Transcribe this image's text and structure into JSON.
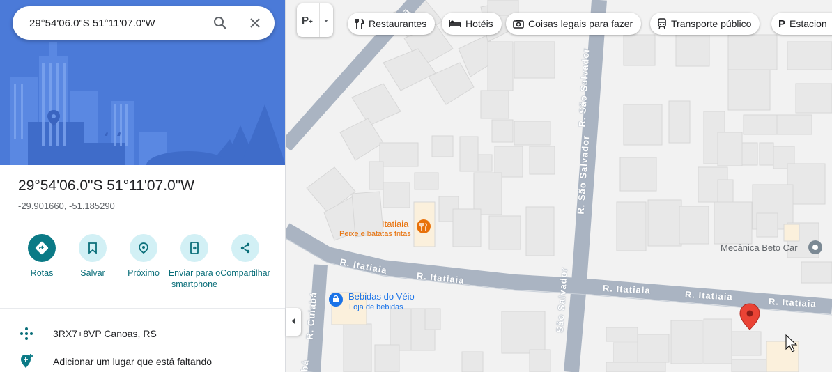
{
  "search": {
    "value": "29°54'06.0\"S 51°11'07.0\"W",
    "search_icon": "search-icon",
    "clear_icon": "close-icon"
  },
  "place": {
    "title": "29°54'06.0\"S 51°11'07.0\"W",
    "coords": "-29.901660, -51.185290"
  },
  "actions": [
    {
      "label": "Rotas",
      "icon": "directions-icon"
    },
    {
      "label": "Salvar",
      "icon": "bookmark-icon"
    },
    {
      "label": "Próximo",
      "icon": "nearby-icon"
    },
    {
      "label": "Enviar para o smartphone",
      "icon": "send-to-phone-icon"
    },
    {
      "label": "Compartilhar",
      "icon": "share-icon"
    }
  ],
  "info": [
    {
      "text": "3RX7+8VP Canoas, RS",
      "icon": "plus-code-icon"
    },
    {
      "text": "Adicionar um lugar que está faltando",
      "icon": "add-place-icon"
    }
  ],
  "chips": [
    {
      "label": "Restaurantes",
      "icon": "restaurant-icon"
    },
    {
      "label": "Hotéis",
      "icon": "hotel-icon"
    },
    {
      "label": "Coisas legais para fazer",
      "icon": "camera-icon"
    },
    {
      "label": "Transporte público",
      "icon": "transit-icon"
    },
    {
      "label": "Estacion",
      "icon": "parking-icon"
    }
  ],
  "map": {
    "streets": {
      "itatiaia": "R. Itatiaia",
      "sao_salvador": "R. São Salvador",
      "cuiaba": "R. Cuiabá",
      "cuiaba_partial": "abá",
      "sao_salvador_partial": "São Salvador",
      "top_partial": "Sã"
    },
    "pois": {
      "itatiaia_restaurant": {
        "name": "Itatiaia",
        "category": "Peixe e batatas fritas"
      },
      "bebidas": {
        "name": "Bebidas do Véio",
        "category": "Loja de bebidas"
      },
      "mecanica": {
        "name": "Mecânica Beto Car"
      }
    },
    "colors": {
      "road": "#aab4c2",
      "building": "#e8e8e8",
      "food": "#e8710a",
      "shop": "#1a73e8",
      "pin": "#ea4335"
    }
  }
}
